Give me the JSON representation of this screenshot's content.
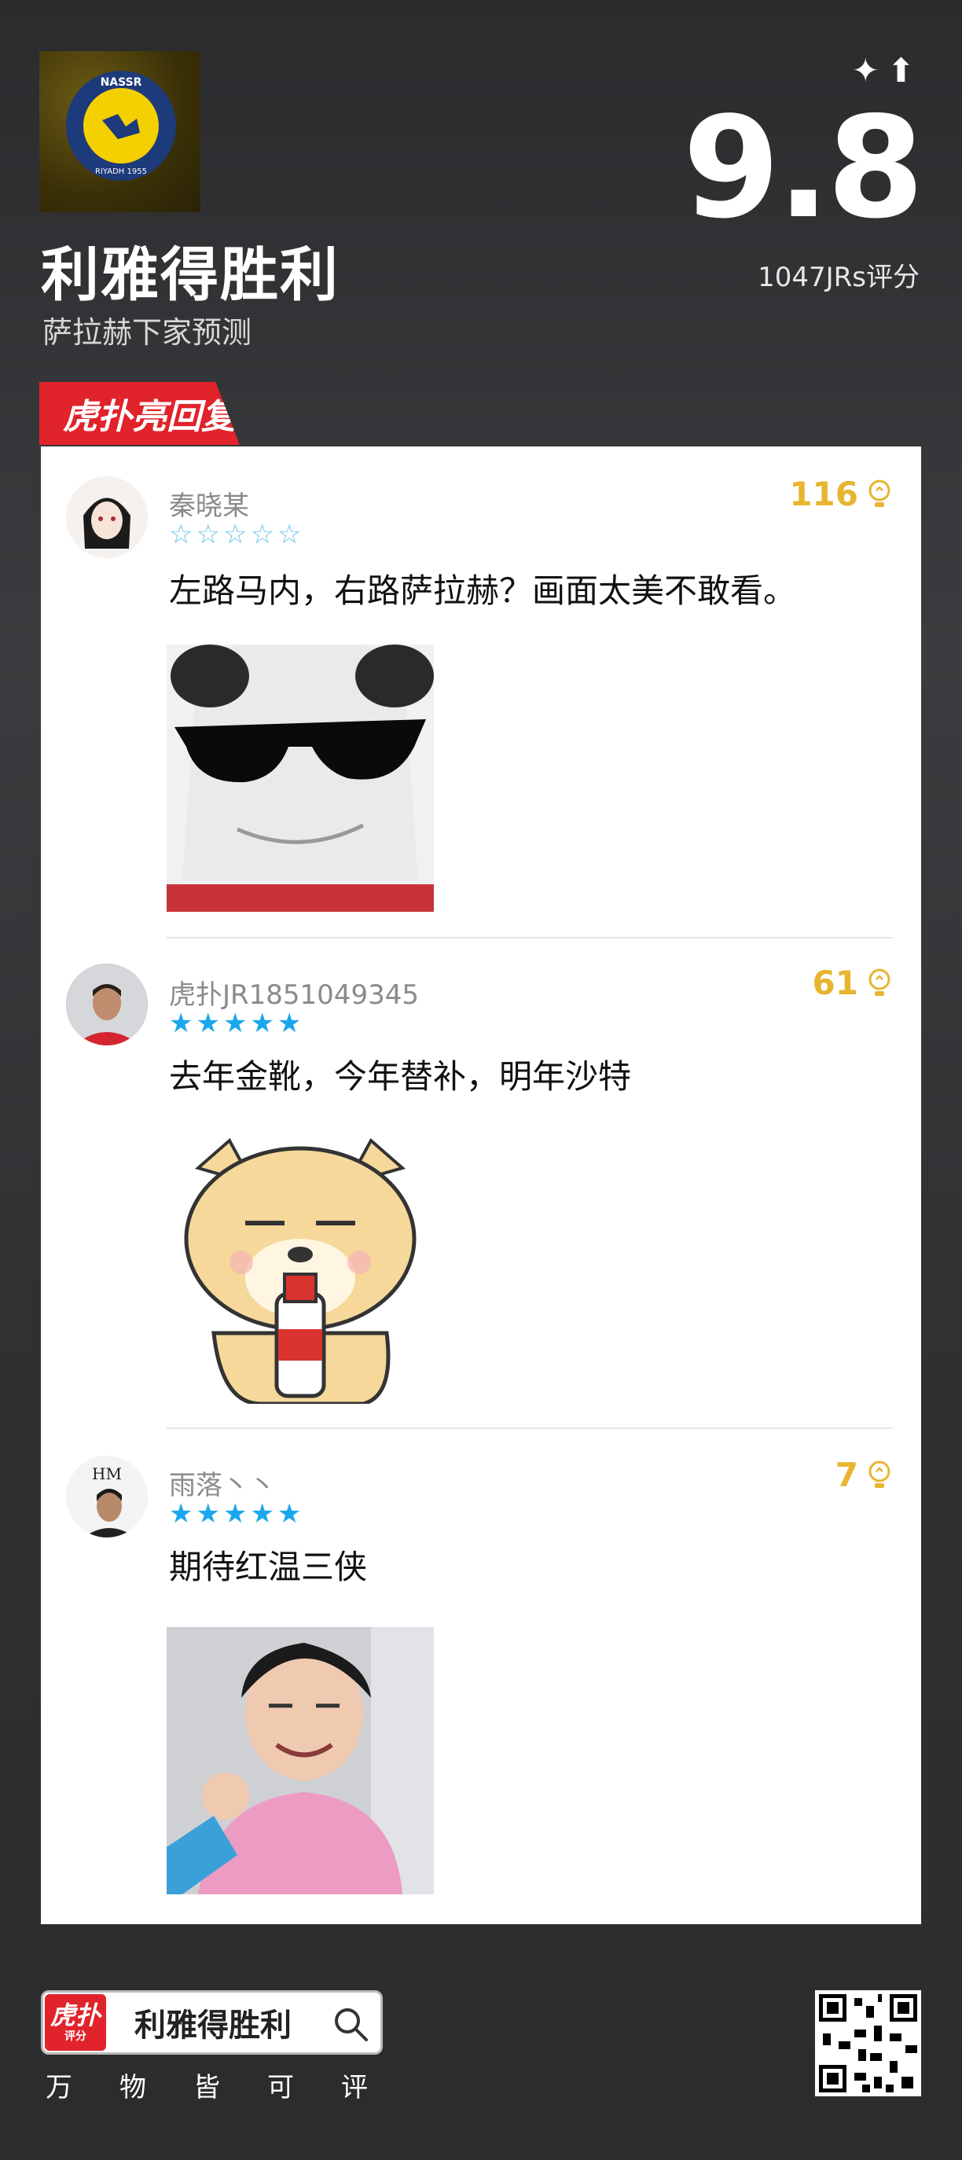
{
  "header": {
    "title": "利雅得胜利",
    "subtitle": "萨拉赫下家预测",
    "score": "9.8",
    "rating_count": "1047JRs评分",
    "logo_text_top": "NASSR",
    "logo_text_bottom": "RIYADH 1955"
  },
  "section_badge": "虎扑亮回复",
  "comments": [
    {
      "username": "秦晓某",
      "stars": "☆☆☆☆☆",
      "likes": "116",
      "text": "左路马内，右路萨拉赫？画面太美不敢看。",
      "image": "sunglasses-meme"
    },
    {
      "username": "虎扑JR1851049345",
      "stars": "★★★★★",
      "likes": "61",
      "text": "去年金靴，今年替补，明年沙特",
      "image": "dog-with-liquor-sticker"
    },
    {
      "username": "雨落丶丶",
      "stars": "★★★★★",
      "likes": "7",
      "text": "期待红温三侠",
      "image": "pointing-person-photo",
      "avatar_text": "HM"
    }
  ],
  "footer": {
    "logo_text": "虎扑",
    "logo_sub": "评分",
    "search_text": "利雅得胜利",
    "slogan": "万物皆可评"
  },
  "colors": {
    "accent_red": "#e1232b",
    "likes_gold": "#e8b530",
    "star_blue": "#1aa7ec"
  }
}
